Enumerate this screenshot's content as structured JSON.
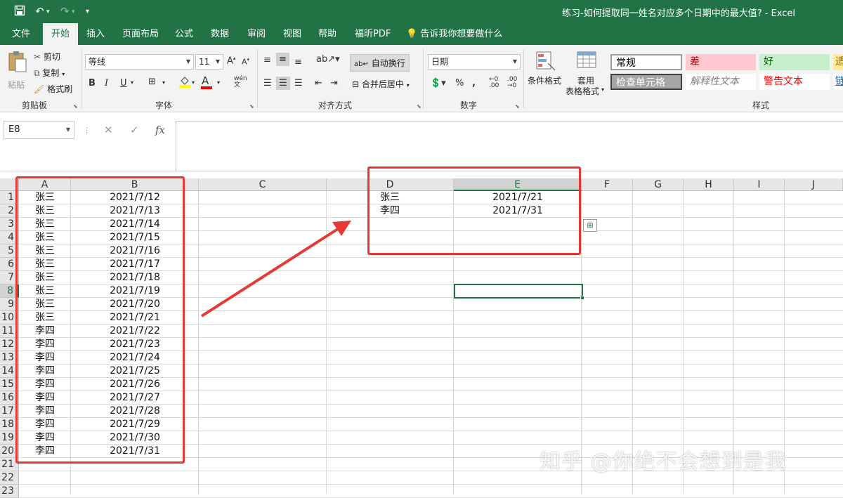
{
  "window": {
    "title": "练习-如何提取同一姓名对应多个日期中的最大值?  -  Excel",
    "quick_access": [
      "save-icon",
      "undo-icon",
      "redo-icon",
      "customize-icon"
    ]
  },
  "ribbon_tabs": [
    "文件",
    "开始",
    "插入",
    "页面布局",
    "公式",
    "数据",
    "审阅",
    "视图",
    "帮助",
    "福昕PDF",
    "告诉我你想要做什么"
  ],
  "active_tab": "开始",
  "ribbon": {
    "clipboard": {
      "paste": "粘贴",
      "cut": "剪切",
      "copy": "复制",
      "format_painter": "格式刷",
      "label": "剪贴板"
    },
    "font": {
      "name": "等线",
      "size": "11",
      "bold": "B",
      "italic": "I",
      "underline": "U",
      "label": "字体"
    },
    "alignment": {
      "wrap": "自动换行",
      "merge": "合并后居中",
      "label": "对齐方式"
    },
    "number": {
      "format": "日期",
      "label": "数字"
    },
    "styles": {
      "conditional": "条件格式",
      "table_format_1": "套用",
      "table_format_2": "表格格式",
      "label": "样式",
      "cells": [
        {
          "text": "常规",
          "bg": "#ffffff",
          "fg": "#000000"
        },
        {
          "text": "差",
          "bg": "#ffc7ce",
          "fg": "#9c0006"
        },
        {
          "text": "好",
          "bg": "#c6efce",
          "fg": "#006100"
        },
        {
          "text": "适",
          "bg": "#ffeb9c",
          "fg": "#9c6500"
        },
        {
          "text": "检查单元格",
          "bg": "#a5a5a5",
          "fg": "#ffffff"
        },
        {
          "text": "解释性文本",
          "bg": "#ffffff",
          "fg": "#7f7f7f"
        },
        {
          "text": "警告文本",
          "bg": "#ffffff",
          "fg": "#ff0000"
        },
        {
          "text": "链",
          "bg": "#ffffff",
          "fg": "#0563c1"
        }
      ]
    }
  },
  "formula_bar": {
    "name_box": "E8",
    "cancel": "✕",
    "enter": "✓",
    "fx": "fx",
    "value": ""
  },
  "columns": [
    "A",
    "B",
    "C",
    "D",
    "E",
    "F",
    "G",
    "H",
    "I",
    "J"
  ],
  "selected_column": "E",
  "selected_row": 8,
  "rows": [
    "1",
    "2",
    "3",
    "4",
    "5",
    "6",
    "7",
    "8",
    "9",
    "10",
    "11",
    "12",
    "13",
    "14",
    "15",
    "16",
    "17",
    "18",
    "19",
    "20",
    "21",
    "22",
    "23"
  ],
  "data_ab": [
    [
      "张三",
      "2021/7/12"
    ],
    [
      "张三",
      "2021/7/13"
    ],
    [
      "张三",
      "2021/7/14"
    ],
    [
      "张三",
      "2021/7/15"
    ],
    [
      "张三",
      "2021/7/16"
    ],
    [
      "张三",
      "2021/7/17"
    ],
    [
      "张三",
      "2021/7/18"
    ],
    [
      "张三",
      "2021/7/19"
    ],
    [
      "张三",
      "2021/7/20"
    ],
    [
      "张三",
      "2021/7/21"
    ],
    [
      "李四",
      "2021/7/22"
    ],
    [
      "李四",
      "2021/7/23"
    ],
    [
      "李四",
      "2021/7/24"
    ],
    [
      "李四",
      "2021/7/25"
    ],
    [
      "李四",
      "2021/7/26"
    ],
    [
      "李四",
      "2021/7/27"
    ],
    [
      "李四",
      "2021/7/28"
    ],
    [
      "李四",
      "2021/7/29"
    ],
    [
      "李四",
      "2021/7/30"
    ],
    [
      "李四",
      "2021/7/31"
    ]
  ],
  "data_de": [
    [
      "张三",
      "2021/7/21"
    ],
    [
      "李四",
      "2021/7/31"
    ]
  ],
  "annotation_color": "#e53935",
  "accent_color": "#217346",
  "watermark": "知乎 @你绝不会想到是我"
}
